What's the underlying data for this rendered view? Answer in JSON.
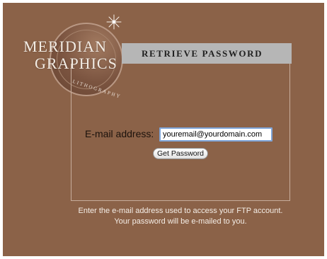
{
  "brand": {
    "line1": "MERIDIAN",
    "line2": "GRAPHICS",
    "tagline": "LITHOGRAPHY"
  },
  "header": {
    "title": "RETRIEVE PASSWORD"
  },
  "form": {
    "email_label": "E-mail address:",
    "email_value": "youremail@yourdomain.com",
    "submit_label": "Get Password"
  },
  "help": {
    "text": "Enter the e-mail address used to access your FTP account. Your password will be e-mailed to you."
  },
  "colors": {
    "background": "#8b6248",
    "header_bar": "#b6b6b6",
    "panel_border": "#c7ad9c",
    "input_focus": "#7fa5d8"
  }
}
